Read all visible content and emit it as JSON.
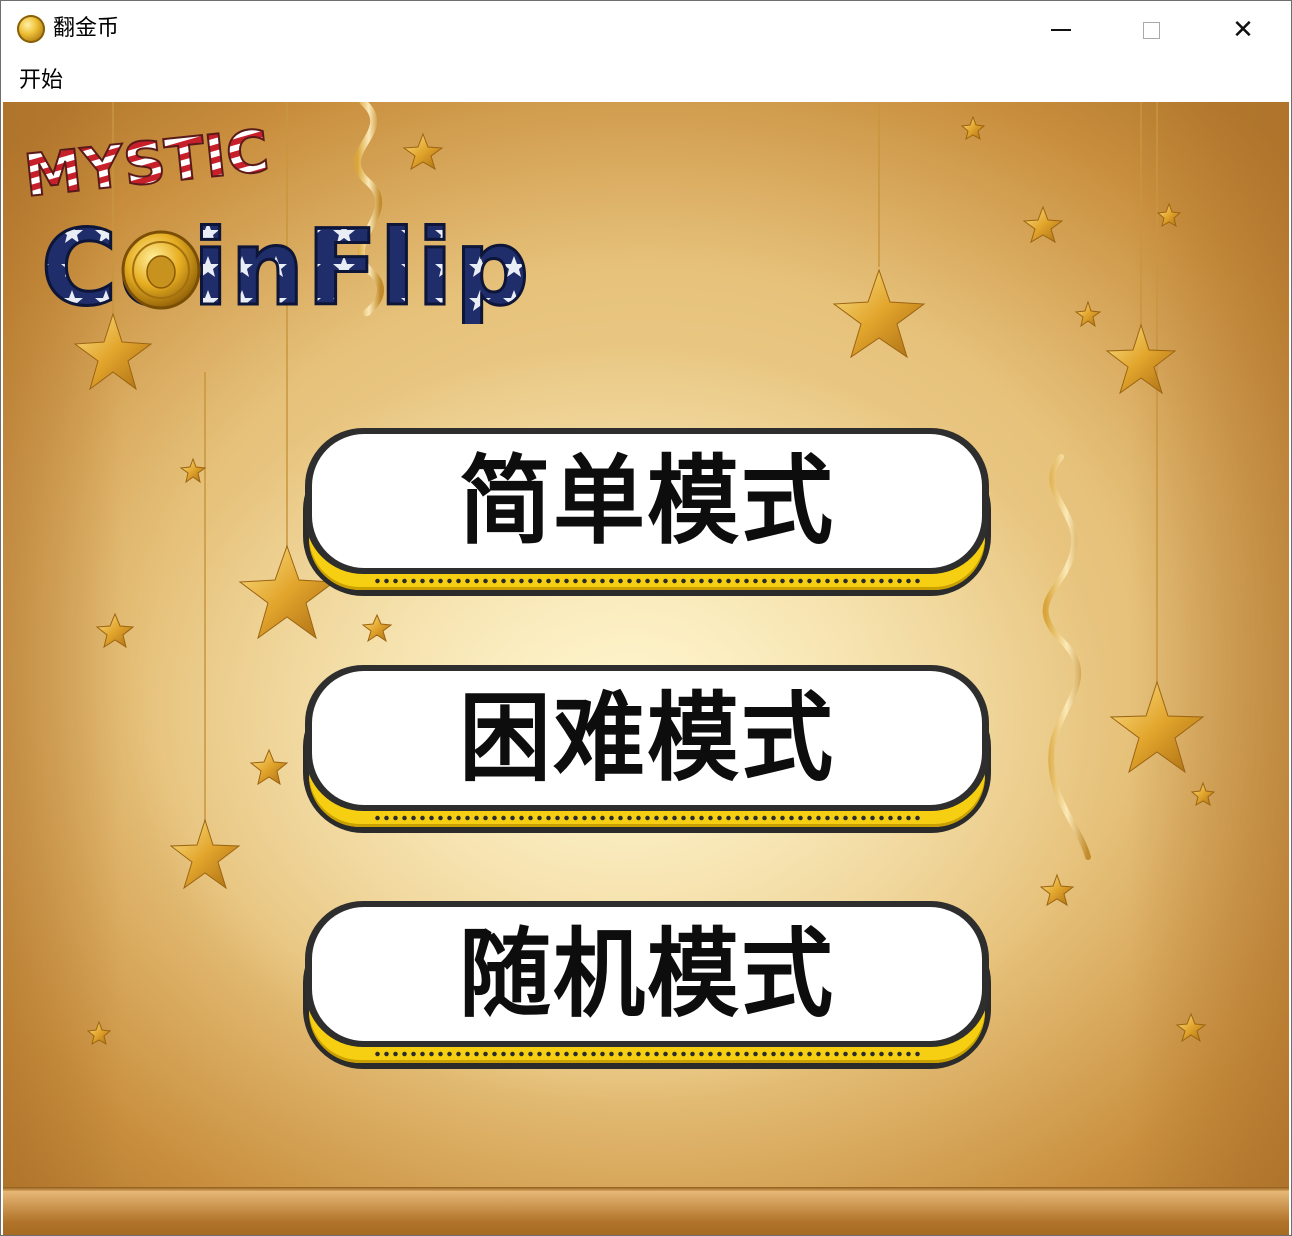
{
  "window": {
    "title": "翻金币",
    "icon": "gold-coin-icon",
    "controls": {
      "minimize_icon": "minimize-icon",
      "maximize_icon": "maximize-icon",
      "close_icon": "close-icon",
      "close_glyph": "✕"
    }
  },
  "menubar": {
    "items": [
      {
        "label": "开始"
      }
    ]
  },
  "game": {
    "logo_line1": "MYSTIC",
    "logo_line2": "CoinFlip",
    "modes": [
      {
        "label": "简单模式"
      },
      {
        "label": "困难模式"
      },
      {
        "label": "随机模式"
      }
    ],
    "colors": {
      "background_gold": "#e6c17a",
      "button_rail_yellow": "#f6cf12",
      "button_face": "#ffffff",
      "button_outline": "#2e2e2e",
      "star_gold": "#e8b63a",
      "logo_navy": "#1f2d6b",
      "logo_red": "#c8202a"
    }
  }
}
